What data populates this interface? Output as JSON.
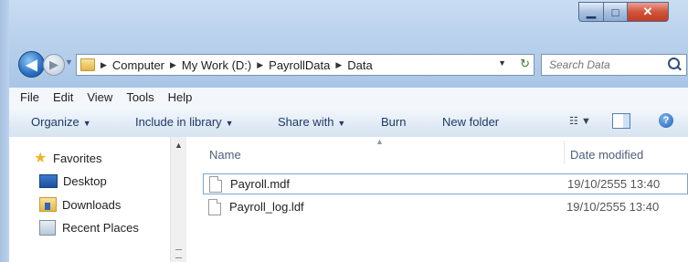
{
  "window": {
    "caption_buttons": {
      "minimize_icon": "minimize-icon",
      "maximize_icon": "maximize-icon",
      "close_icon": "close-icon"
    }
  },
  "address_bar": {
    "crumbs": [
      "Computer",
      "My Work (D:)",
      "PayrollData",
      "Data"
    ]
  },
  "search": {
    "placeholder": "Search Data"
  },
  "menu": [
    "File",
    "Edit",
    "View",
    "Tools",
    "Help"
  ],
  "toolbar": {
    "organize": "Organize",
    "include_in_library": "Include in library",
    "share_with": "Share with",
    "burn": "Burn",
    "new_folder": "New folder"
  },
  "nav_pane": {
    "favorites": "Favorites",
    "items": [
      "Desktop",
      "Downloads",
      "Recent Places"
    ]
  },
  "file_list": {
    "columns": {
      "name": "Name",
      "date_modified": "Date modified"
    },
    "files": [
      {
        "name": "Payroll.mdf",
        "date": "19/10/2555 13:40"
      },
      {
        "name": "Payroll_log.ldf",
        "date": "19/10/2555 13:40"
      }
    ]
  }
}
